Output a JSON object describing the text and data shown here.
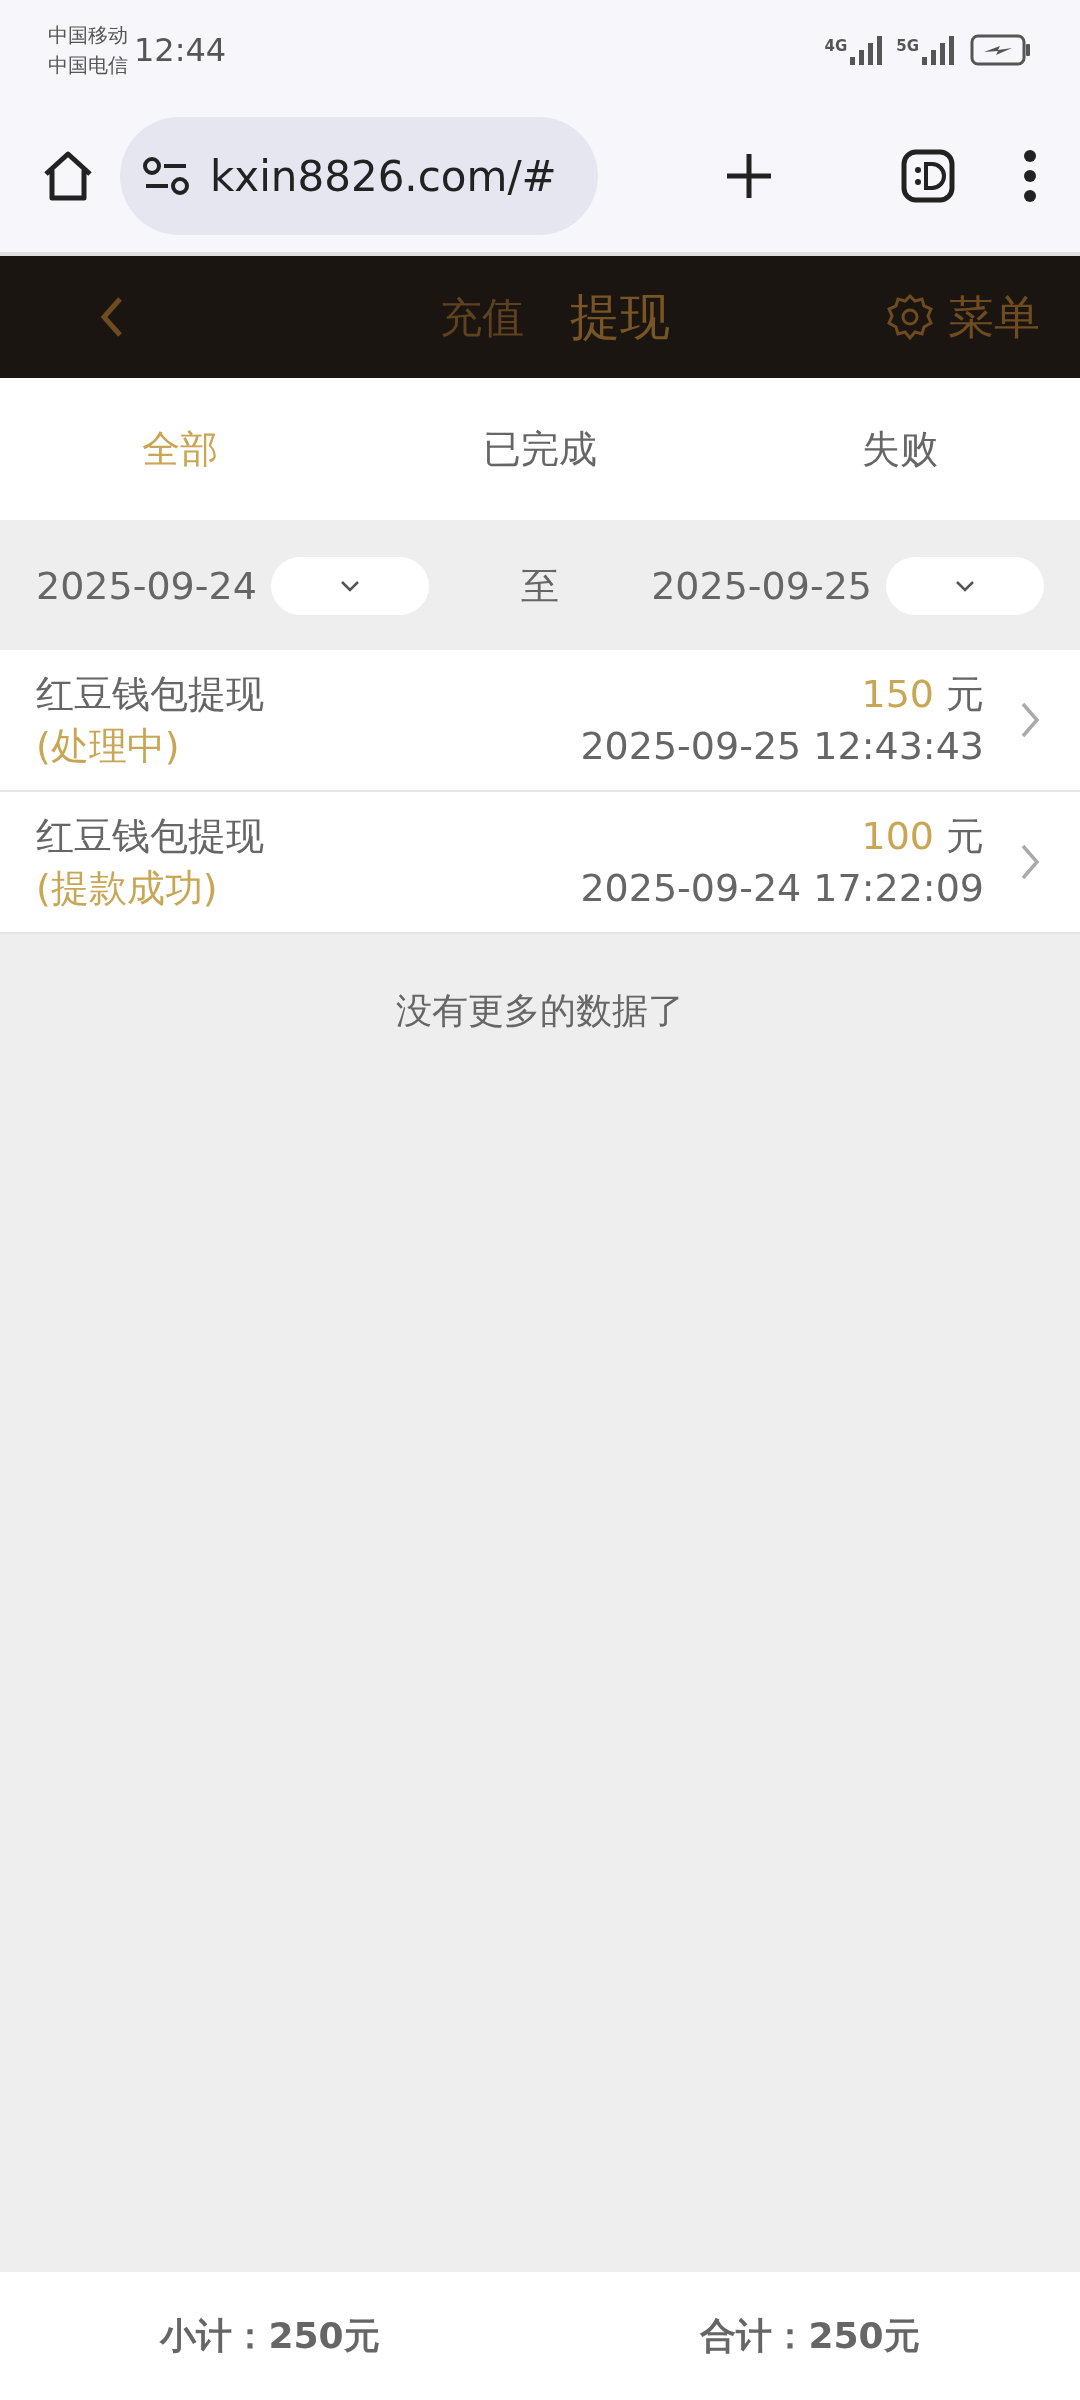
{
  "status_bar": {
    "carriers": [
      "中国移动",
      "中国电信"
    ],
    "time": "12:44",
    "network_labels": [
      "4G",
      "5G"
    ]
  },
  "browser": {
    "url": "kxin8826.com/#"
  },
  "header": {
    "tabs": [
      {
        "label": "充值",
        "selected": false
      },
      {
        "label": "提现",
        "selected": true
      }
    ],
    "menu": "菜单"
  },
  "filter_tabs": [
    {
      "label": "全部",
      "selected": true
    },
    {
      "label": "已完成",
      "selected": false
    },
    {
      "label": "失败",
      "selected": false
    }
  ],
  "date_range": {
    "start": "2025-09-24",
    "separator": "至",
    "end": "2025-09-25"
  },
  "records": [
    {
      "title": "红豆钱包提现",
      "status": "(处理中)",
      "amount": "150",
      "unit": "元",
      "time": "2025-09-25 12:43:43"
    },
    {
      "title": "红豆钱包提现",
      "status": "(提款成功)",
      "amount": "100",
      "unit": "元",
      "time": "2025-09-24 17:22:09"
    }
  ],
  "end_message": "没有更多的数据了",
  "footer": {
    "subtotal": "小计：250元",
    "total": "合计：250元"
  }
}
